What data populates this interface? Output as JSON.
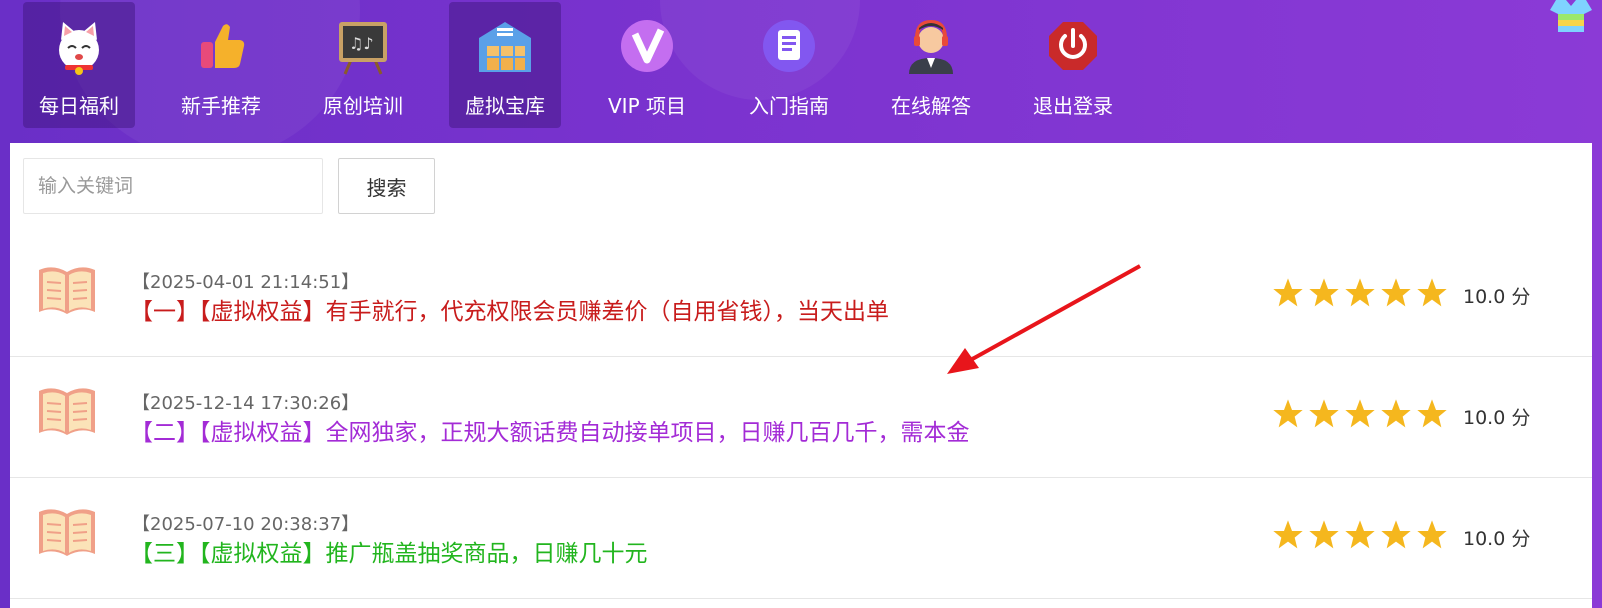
{
  "nav": {
    "items": [
      {
        "label": "每日福利",
        "icon": "lucky-cat-icon",
        "active": true
      },
      {
        "label": "新手推荐",
        "icon": "thumbs-up-icon",
        "active": false
      },
      {
        "label": "原创培训",
        "icon": "chalkboard-icon",
        "active": false
      },
      {
        "label": "虚拟宝库",
        "icon": "warehouse-icon",
        "active": true
      },
      {
        "label": "VIP 项目",
        "icon": "vip-icon",
        "active": false
      },
      {
        "label": "入门指南",
        "icon": "document-icon",
        "active": false
      },
      {
        "label": "在线解答",
        "icon": "support-agent-icon",
        "active": false
      },
      {
        "label": "退出登录",
        "icon": "power-icon",
        "active": false
      }
    ]
  },
  "search": {
    "placeholder": "输入关键词",
    "button_label": "搜索"
  },
  "articles": [
    {
      "date": "【2025-04-01 21:14:51】",
      "title": "【一】【虚拟权益】有手就行，代充权限会员赚差价（自用省钱），当天出单",
      "color": "#c81c1c",
      "stars": 5,
      "score": "10.0 分"
    },
    {
      "date": "【2025-12-14 17:30:26】",
      "title": "【二】【虚拟权益】全网独家，正规大额话费自动接单项目，日赚几百几千，需本金",
      "color": "#a32bd6",
      "stars": 5,
      "score": "10.0 分"
    },
    {
      "date": "【2025-07-10 20:38:37】",
      "title": "【三】【虚拟权益】推广瓶盖抽奖商品，日赚几十元",
      "color": "#22b51e",
      "stars": 5,
      "score": "10.0 分"
    }
  ],
  "colors": {
    "header": "#7b33cf",
    "star": "#f5b71e",
    "arrow": "#e8151b"
  }
}
